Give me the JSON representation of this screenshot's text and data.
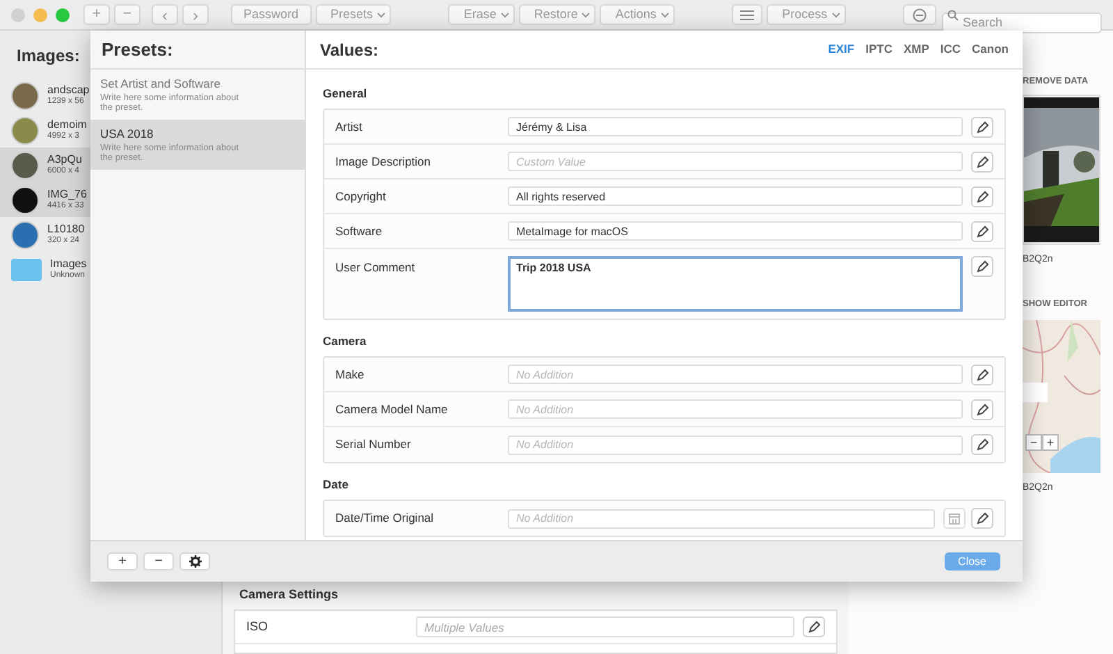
{
  "toolbar": {
    "groups": [
      [
        {
          "kind": "add",
          "label": "+"
        },
        {
          "kind": "remove",
          "label": "−"
        }
      ],
      [
        {
          "kind": "back",
          "label": "‹"
        },
        {
          "kind": "forward",
          "label": "›"
        }
      ],
      [
        {
          "kind": "button",
          "label": "Password"
        },
        {
          "kind": "dropdown",
          "label": "Presets"
        }
      ],
      [
        {
          "kind": "dropdown",
          "label": "Erase"
        },
        {
          "kind": "dropdown",
          "label": "Restore"
        },
        {
          "kind": "dropdown",
          "label": "Actions"
        }
      ],
      [
        {
          "kind": "list"
        },
        {
          "kind": "dropdown",
          "label": "Process"
        }
      ],
      [
        {
          "kind": "clear"
        }
      ]
    ],
    "search": {
      "placeholder": "Search"
    }
  },
  "images": {
    "title": "Images:",
    "items": [
      {
        "name": "andscap",
        "size": "1239 x 56",
        "selected": false,
        "color": "#7a6a4a"
      },
      {
        "name": "demoim",
        "size": "4992 x 3",
        "selected": false,
        "color": "#8a8a4a"
      },
      {
        "name": "A3pQu",
        "size": "6000 x 4",
        "selected": true,
        "color": "#5a5a4a"
      },
      {
        "name": "IMG_76",
        "size": "4416 x 33",
        "selected": true,
        "color": "#111111"
      },
      {
        "name": "L10180",
        "size": "320 x 24",
        "selected": false,
        "color": "#2a6fb0"
      },
      {
        "kind": "folder",
        "name": "Images",
        "size": "Unknown",
        "selected": false,
        "color": "#6cc3ef"
      }
    ]
  },
  "background": {
    "section": "Camera Settings",
    "rows": [
      {
        "label": "ISO",
        "placeholder": "Multiple Values"
      }
    ]
  },
  "right_panel": {
    "remove_data": "REMOVE DATA",
    "photo_caption": "B2Q2n",
    "show_editor": "SHOW EDITOR",
    "map_caption": "B2Q2n",
    "zoom_out": "−",
    "zoom_in": "+"
  },
  "sheet": {
    "presets": {
      "title": "Presets:",
      "items": [
        {
          "name": "Set Artist and Software",
          "description": "Write here some information about the preset.",
          "selected": false
        },
        {
          "name": "USA 2018",
          "description": "Write here some information about the preset.",
          "selected": true
        }
      ]
    },
    "values": {
      "title": "Values:",
      "tabs": [
        {
          "label": "EXIF",
          "selected": true
        },
        {
          "label": "IPTC",
          "selected": false
        },
        {
          "label": "XMP",
          "selected": false
        },
        {
          "label": "ICC",
          "selected": false
        },
        {
          "label": "Canon",
          "selected": false
        }
      ],
      "sections": [
        {
          "title": "General",
          "rows": [
            {
              "kind": "text",
              "label": "Artist",
              "value": "Jérémy & Lisa"
            },
            {
              "kind": "text",
              "label": "Image Description",
              "placeholder": "Custom Value"
            },
            {
              "kind": "text",
              "label": "Copyright",
              "value": "All rights reserved"
            },
            {
              "kind": "text",
              "label": "Software",
              "value": "MetaImage for macOS"
            },
            {
              "kind": "textarea",
              "label": "User Comment",
              "value": "Trip 2018 USA",
              "focused": true
            }
          ]
        },
        {
          "title": "Camera",
          "rows": [
            {
              "kind": "text",
              "label": "Make",
              "placeholder": "No Addition"
            },
            {
              "kind": "text",
              "label": "Camera Model Name",
              "placeholder": "No Addition"
            },
            {
              "kind": "text",
              "label": "Serial Number",
              "placeholder": "No Addition"
            }
          ]
        },
        {
          "title": "Date",
          "rows": [
            {
              "kind": "date",
              "label": "Date/Time Original",
              "placeholder": "No Addition"
            }
          ]
        }
      ]
    },
    "footer": {
      "buttons": [
        {
          "kind": "add",
          "label": "+"
        },
        {
          "kind": "remove",
          "label": "−"
        },
        {
          "kind": "settings"
        }
      ],
      "close": "Close"
    }
  }
}
